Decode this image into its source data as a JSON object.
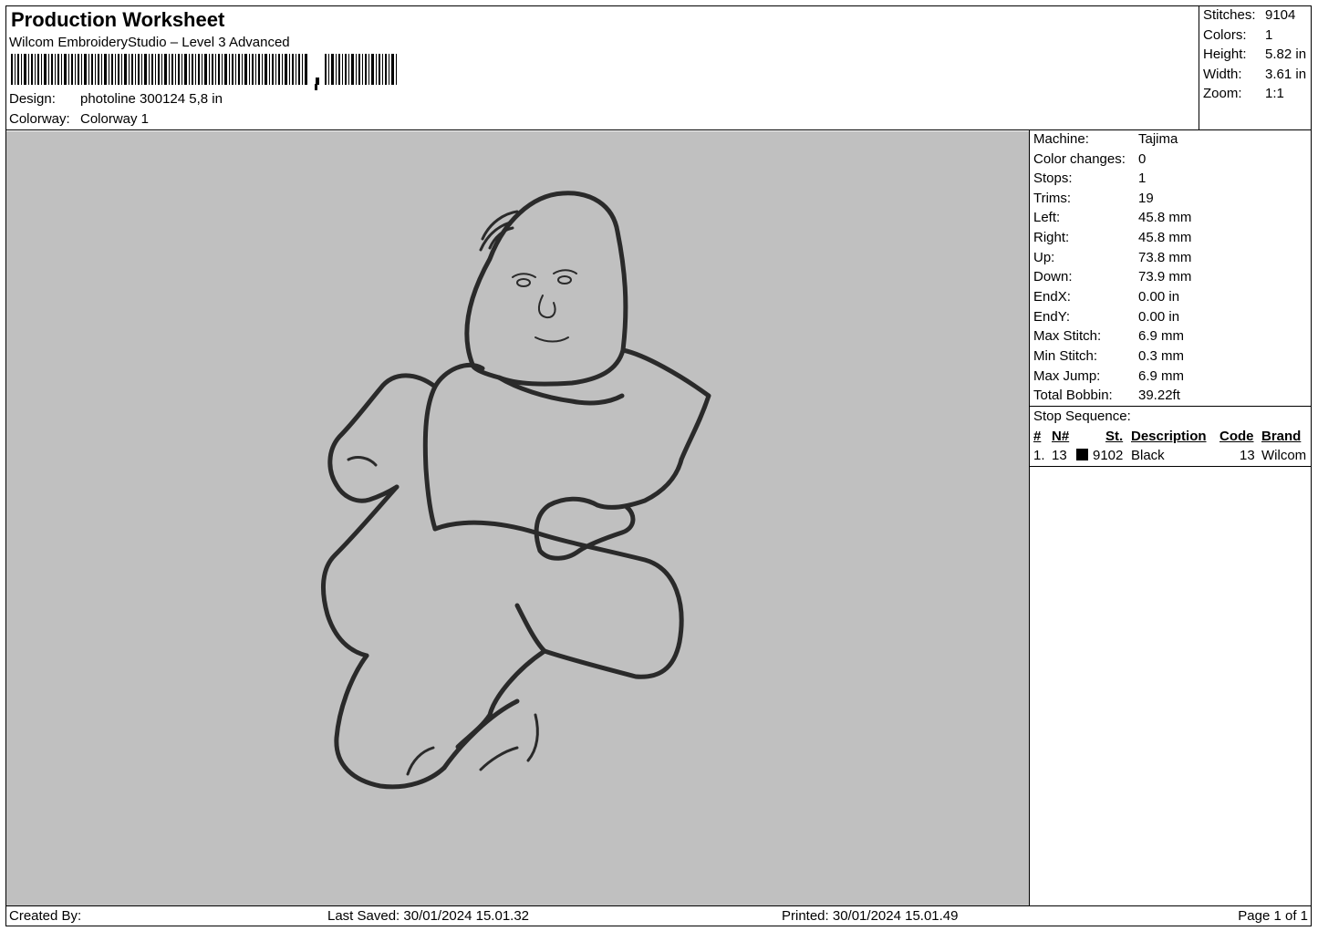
{
  "header": {
    "title": "Production Worksheet",
    "software": "Wilcom EmbroideryStudio – Level 3 Advanced",
    "design_label": "Design:",
    "design_value": "photoline 300124 5,8 in",
    "colorway_label": "Colorway:",
    "colorway_value": "Colorway 1"
  },
  "summary": {
    "stitches_label": "Stitches:",
    "stitches": "9104",
    "colors_label": "Colors:",
    "colors": "1",
    "height_label": "Height:",
    "height": "5.82 in",
    "width_label": "Width:",
    "width": "3.61 in",
    "zoom_label": "Zoom:",
    "zoom": "1:1"
  },
  "machine": {
    "machine_label": "Machine:",
    "machine": "Tajima",
    "color_changes_label": "Color changes:",
    "color_changes": "0",
    "stops_label": "Stops:",
    "stops": "1",
    "trims_label": "Trims:",
    "trims": "19",
    "left_label": "Left:",
    "left": "45.8 mm",
    "right_label": "Right:",
    "right": "45.8 mm",
    "up_label": "Up:",
    "up": "73.8 mm",
    "down_label": "Down:",
    "down": "73.9 mm",
    "endx_label": "EndX:",
    "endx": "0.00 in",
    "endy_label": "EndY:",
    "endy": "0.00 in",
    "max_stitch_label": "Max Stitch:",
    "max_stitch": "6.9 mm",
    "min_stitch_label": "Min Stitch:",
    "min_stitch": "0.3 mm",
    "max_jump_label": "Max Jump:",
    "max_jump": "6.9 mm",
    "total_bobbin_label": "Total Bobbin:",
    "total_bobbin": "39.22ft"
  },
  "stop_sequence": {
    "title": "Stop Sequence:",
    "headers": {
      "num": "#",
      "n": "N#",
      "st": "St.",
      "description": "Description",
      "code": "Code",
      "brand": "Brand"
    },
    "rows": [
      {
        "num": "1.",
        "n": "13",
        "swatch_color": "#000000",
        "st": "9102",
        "description": "Black",
        "code": "13",
        "brand": "Wilcom"
      }
    ]
  },
  "footer": {
    "created_by": "Created By:",
    "last_saved": "Last Saved: 30/01/2024 15.01.32",
    "printed": "Printed: 30/01/2024 15.01.49",
    "page": "Page 1 of 1"
  },
  "design_preview": {
    "background": "#c0c0c0",
    "thread_color": "#2a2a2a"
  }
}
